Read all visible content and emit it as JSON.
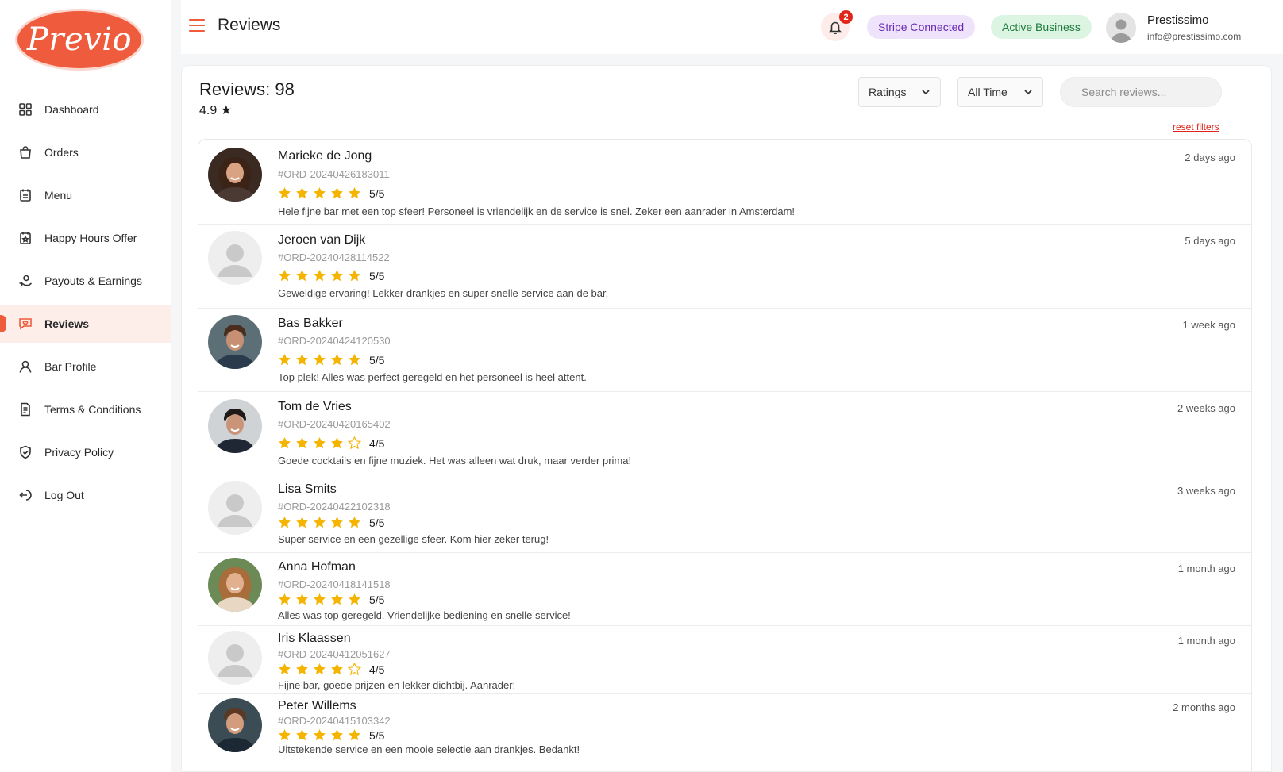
{
  "brand": {
    "logo_text": "Previo",
    "accent": "#ef5b3d"
  },
  "sidebar": {
    "items": [
      {
        "label": "Dashboard",
        "icon": "grid-icon",
        "active": false
      },
      {
        "label": "Orders",
        "icon": "shopping-bag-icon",
        "active": false
      },
      {
        "label": "Menu",
        "icon": "menu-icon",
        "active": false
      },
      {
        "label": "Happy Hours Offer",
        "icon": "offer-icon",
        "active": false
      },
      {
        "label": "Payouts & Earnings",
        "icon": "money-hand-icon",
        "active": false
      },
      {
        "label": "Reviews",
        "icon": "chat-heart-icon",
        "active": true
      },
      {
        "label": "Bar Profile",
        "icon": "user-icon",
        "active": false
      },
      {
        "label": "Terms & Conditions",
        "icon": "document-icon",
        "active": false
      },
      {
        "label": "Privacy Policy",
        "icon": "shield-icon",
        "active": false
      },
      {
        "label": "Log Out",
        "icon": "logout-icon",
        "active": false
      }
    ]
  },
  "header": {
    "title": "Reviews",
    "notifications": "2",
    "stripe_badge": "Stripe Connected",
    "business_badge": "Active Business",
    "user_name": "Prestissimo",
    "user_email": "info@prestissimo.com"
  },
  "summary": {
    "count_label": "Reviews: 98",
    "average": "4.9 ★"
  },
  "filters": {
    "ratings": "Ratings",
    "time": "All Time",
    "search_placeholder": "Search reviews...",
    "reset": "reset filters"
  },
  "reviews": [
    {
      "name": "Marieke de Jong",
      "order": "#ORD-20240426183011",
      "stars": 5,
      "rating": "5/5",
      "text": "Hele fijne bar met een top sfeer! Personeel is vriendelijk en de service is snel. Zeker een aanrader in Amsterdam!",
      "time": "2 days ago",
      "avatar": "photo-woman-dark"
    },
    {
      "name": "Jeroen van Dijk",
      "order": "#ORD-20240428114522",
      "stars": 5,
      "rating": "5/5",
      "text": "Geweldige ervaring! Lekker drankjes en super snelle service aan de bar.",
      "time": "5 days ago",
      "avatar": "placeholder"
    },
    {
      "name": "Bas Bakker",
      "order": "#ORD-20240424120530",
      "stars": 5,
      "rating": "5/5",
      "text": "Top plek! Alles was perfect geregeld en het personeel is heel attent.",
      "time": "1 week ago",
      "avatar": "photo-man-brown"
    },
    {
      "name": "Tom de Vries",
      "order": "#ORD-20240420165402",
      "stars": 4,
      "rating": "4/5",
      "text": "Goede cocktails en fijne muziek. Het was alleen wat druk, maar verder prima!",
      "time": "2 weeks ago",
      "avatar": "photo-man-dark"
    },
    {
      "name": "Lisa Smits",
      "order": "#ORD-20240422102318",
      "stars": 5,
      "rating": "5/5",
      "text": "Super service en een gezellige sfeer. Kom hier zeker terug!",
      "time": "3 weeks ago",
      "avatar": "placeholder"
    },
    {
      "name": "Anna Hofman",
      "order": "#ORD-20240418141518",
      "stars": 5,
      "rating": "5/5",
      "text": "Alles was top geregeld. Vriendelijke bediening en snelle service!",
      "time": "1 month ago",
      "avatar": "photo-woman-light"
    },
    {
      "name": "Iris Klaassen",
      "order": "#ORD-20240412051627",
      "stars": 4,
      "rating": "4/5",
      "text": "Fijne bar, goede prijzen en lekker dichtbij. Aanrader!",
      "time": "1 month ago",
      "avatar": "placeholder"
    },
    {
      "name": "Peter Willems",
      "order": "#ORD-20240415103342",
      "stars": 5,
      "rating": "5/5",
      "text": "Uitstekende service en een mooie selectie aan drankjes. Bedankt!",
      "time": "2 months ago",
      "avatar": "photo-man-smile"
    }
  ]
}
